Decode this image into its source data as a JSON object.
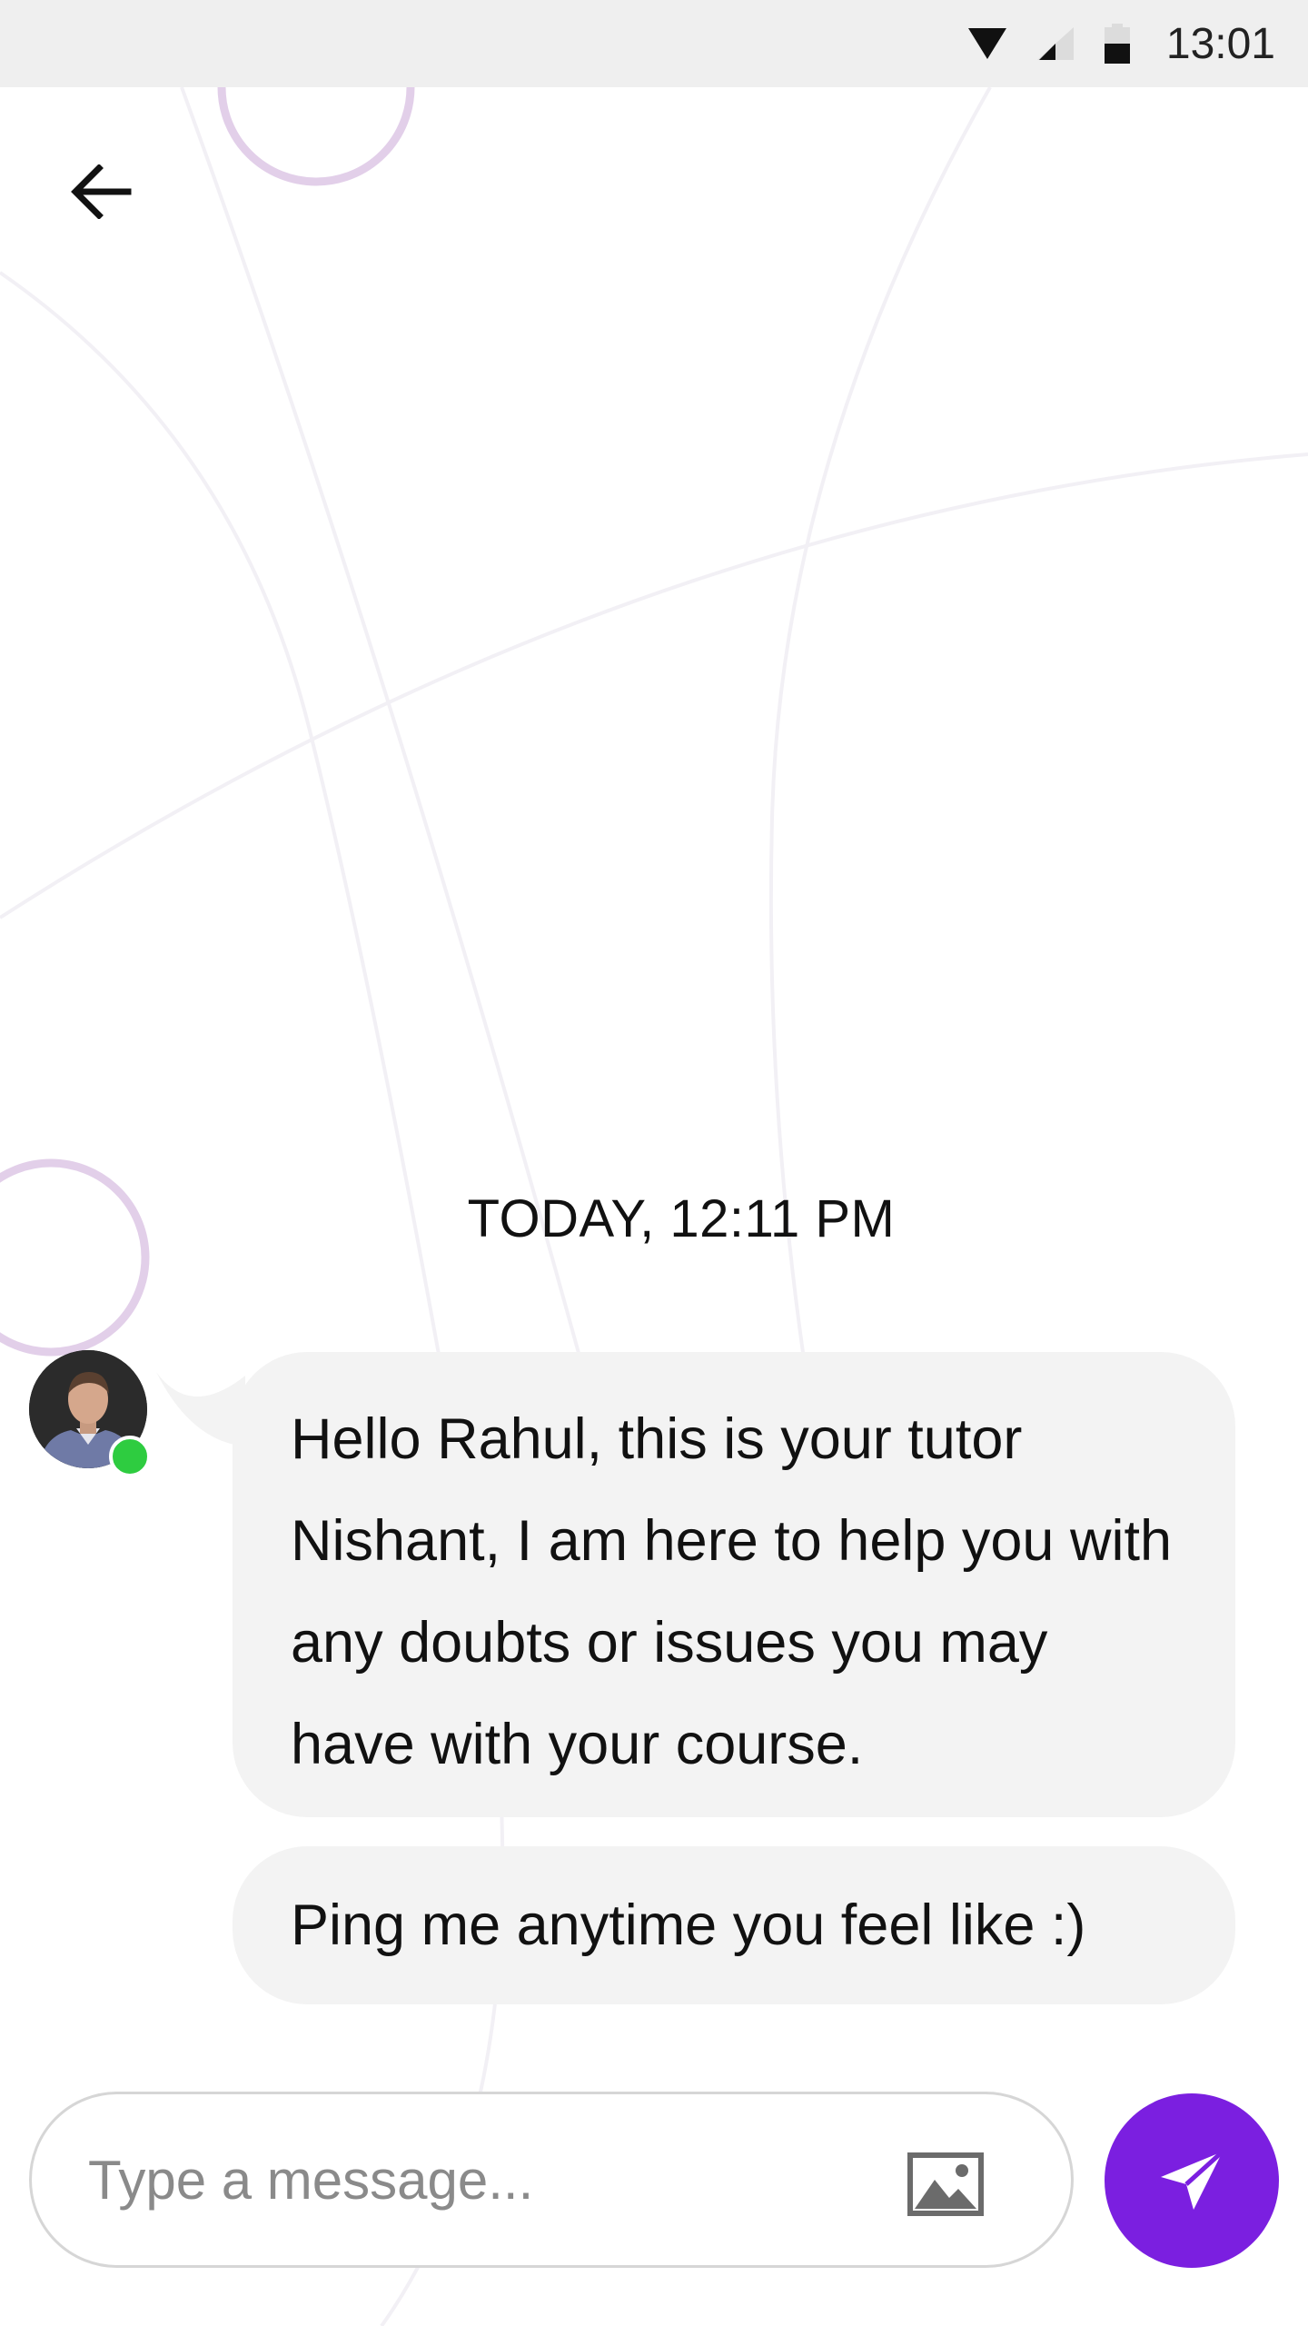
{
  "status_bar": {
    "time": "13:01",
    "icons": [
      "wifi-icon",
      "signal-icon",
      "battery-icon"
    ]
  },
  "header": {
    "back_icon": "arrow-left-icon"
  },
  "chat": {
    "timestamp": "TODAY, 12:11 PM",
    "tutor_online": true,
    "messages": [
      {
        "from": "tutor",
        "text": "Hello Rahul, this is your tutor Nishant, I am here to help you with any doubts or issues you may have with your course."
      },
      {
        "from": "tutor",
        "text": "Ping me anytime you feel like :)"
      }
    ]
  },
  "composer": {
    "placeholder": "Type a message...",
    "value": "",
    "attach_icon": "image-icon",
    "send_icon": "send-icon"
  },
  "colors": {
    "accent": "#7b1fe0",
    "online": "#2ecc40",
    "bubble": "#f3f3f3",
    "status_bar": "#efefef",
    "decor_ring": "#e2cfe9"
  }
}
